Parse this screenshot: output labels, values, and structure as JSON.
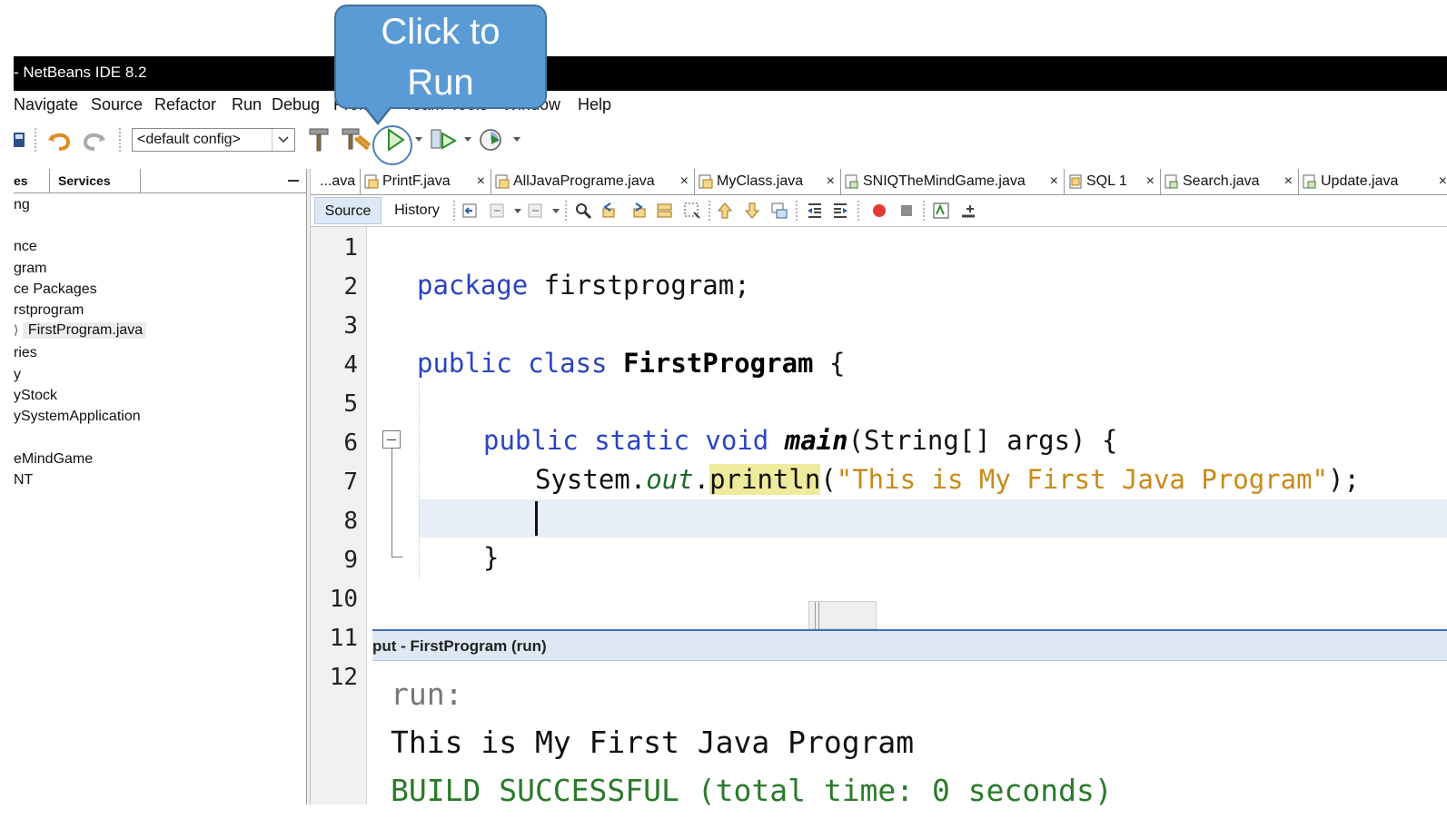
{
  "window": {
    "title": "- NetBeans IDE 8.2"
  },
  "menu": [
    "Navigate",
    "Source",
    "Refactor",
    "Run",
    "Debug",
    "Profile",
    "Team",
    "Tools",
    "Window",
    "Help"
  ],
  "toolbar": {
    "config_value": "<default config>"
  },
  "callout": {
    "line1": "Click to",
    "line2": "Run",
    "color": "#5b9bd5"
  },
  "left_panel": {
    "tabs": [
      "es",
      "Services"
    ],
    "tree": [
      "ng",
      "nce",
      "gram",
      "ce Packages",
      "rstprogram",
      "FirstProgram.java",
      "ries",
      "y",
      "yStock",
      "ySystemApplication",
      "eMindGame",
      "NT"
    ]
  },
  "editor_tabs": [
    "...ava",
    "PrintF.java",
    "AllJavaPrograme.java",
    "MyClass.java",
    "SNIQTheMindGame.java",
    "SQL 1",
    "Search.java",
    "Update.java"
  ],
  "editor_toolbar": {
    "source": "Source",
    "history": "History"
  },
  "code": {
    "line_numbers": [
      "1",
      "2",
      "3",
      "4",
      "5",
      "6",
      "7",
      "8",
      "9",
      "10",
      "11",
      "12"
    ],
    "l2_kw": "package",
    "l2_rest": " firstprogram;",
    "l4_kw": "public class",
    "l4_name": "FirstProgram",
    "l4_brace": " {",
    "l6_kw": "public static void",
    "l6_method": "main",
    "l6_rest": "(String[] args) {",
    "l7_obj": "System.",
    "l7_field": "out",
    "l7_dot": ".",
    "l7_method": "println",
    "l7_open": "(",
    "l7_str": "\"This is My First Java Program\"",
    "l7_close": ");",
    "l9": "}"
  },
  "output": {
    "title": "put - FirstProgram (run)",
    "lines": [
      "run:",
      "This is My First Java Program",
      "BUILD SUCCESSFUL (total time: 0 seconds)"
    ]
  },
  "colors": {
    "keyword": "#2b44c0",
    "string": "#c98a1a",
    "build_success": "#2a7a2a",
    "accent": "#3d71b0"
  }
}
